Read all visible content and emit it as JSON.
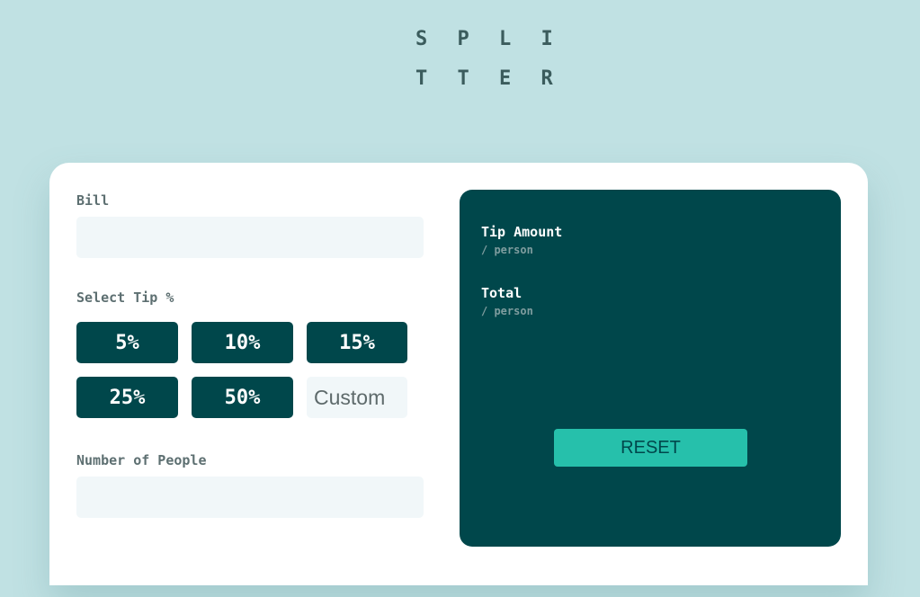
{
  "app": {
    "logo_line1": "S P L I",
    "logo_line2": "T T E R"
  },
  "form": {
    "bill_label": "Bill",
    "bill_value": "",
    "tip_label": "Select Tip %",
    "tips": [
      "5%",
      "10%",
      "15%",
      "25%",
      "50%"
    ],
    "custom_placeholder": "Custom",
    "people_label": "Number of People",
    "people_value": ""
  },
  "results": {
    "tip_amount_label": "Tip Amount",
    "tip_amount_sub": "/ person",
    "total_label": "Total",
    "total_sub": "/ person",
    "reset_label": "RESET"
  },
  "colors": {
    "background": "#c0e1e3",
    "dark_cyan": "#00474b",
    "strong_cyan": "#26c0ab",
    "input_bg": "#f1f7f9"
  }
}
